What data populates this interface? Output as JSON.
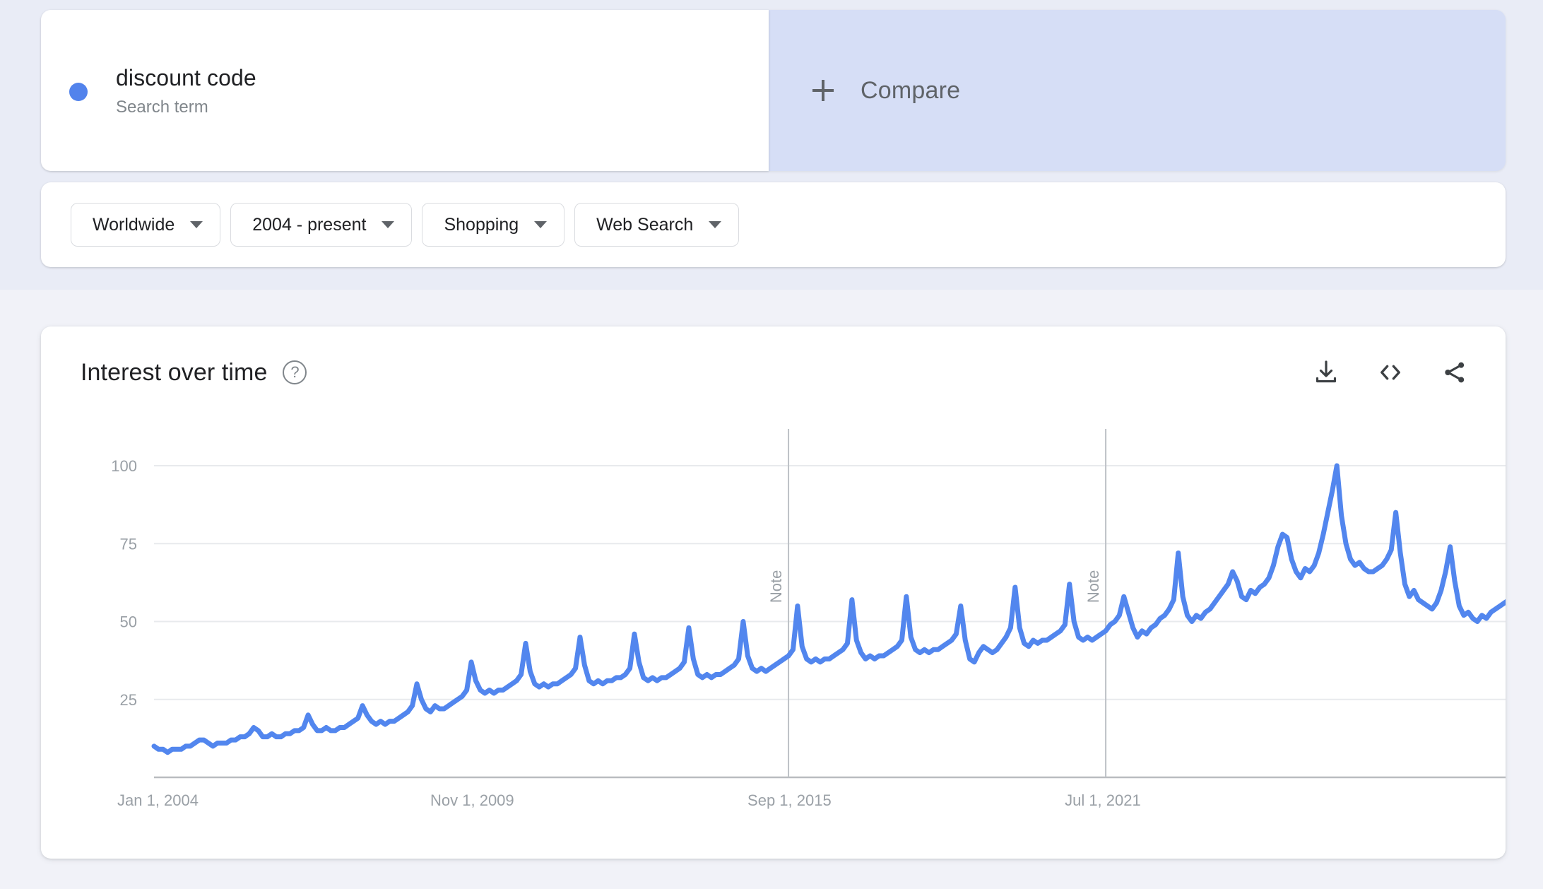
{
  "search_term": {
    "name": "discount code",
    "type_label": "Search term",
    "dot_color": "#5283ec"
  },
  "compare": {
    "label": "Compare",
    "plus_icon": "plus-icon",
    "background": "#d6def6"
  },
  "filters": [
    {
      "label": "Worldwide",
      "icon": "chevron-down-icon"
    },
    {
      "label": "2004 - present",
      "icon": "chevron-down-icon"
    },
    {
      "label": "Shopping",
      "icon": "chevron-down-icon"
    },
    {
      "label": "Web Search",
      "icon": "chevron-down-icon"
    }
  ],
  "chart_card": {
    "title": "Interest over time",
    "help_icon": "help-circle-icon",
    "help_glyph": "?",
    "actions": [
      {
        "name": "download-icon",
        "title": "Download"
      },
      {
        "name": "embed-code-icon",
        "title": "Embed"
      },
      {
        "name": "share-icon",
        "title": "Share"
      }
    ]
  },
  "chart_data": {
    "type": "line",
    "title": "Interest over time",
    "xlabel": "",
    "ylabel": "",
    "ylim": [
      0,
      105
    ],
    "yticks": [
      25,
      50,
      75,
      100
    ],
    "ytick_labels": [
      "25",
      "50",
      "75",
      "100"
    ],
    "grid": true,
    "legend": "none",
    "line_color": "#5286ee",
    "line_width": 7,
    "xtick_labels": [
      "Jan 1, 2004",
      "Nov 1, 2009",
      "Sep 1, 2015",
      "Jul 1, 2021"
    ],
    "xtick_indices": [
      0,
      70,
      140,
      210
    ],
    "annotations": [
      {
        "label": "Note",
        "index": 140
      },
      {
        "label": "Note",
        "index": 210
      }
    ],
    "x_start": "2004-01",
    "x_end": "2023-12",
    "x_interval": "monthly",
    "series": [
      {
        "name": "discount code",
        "color": "#5286ee",
        "values": [
          10,
          9,
          9,
          8,
          9,
          9,
          9,
          10,
          10,
          11,
          12,
          12,
          11,
          10,
          11,
          11,
          11,
          12,
          12,
          13,
          13,
          14,
          16,
          15,
          13,
          13,
          14,
          13,
          13,
          14,
          14,
          15,
          15,
          16,
          20,
          17,
          15,
          15,
          16,
          15,
          15,
          16,
          16,
          17,
          18,
          19,
          23,
          20,
          18,
          17,
          18,
          17,
          18,
          18,
          19,
          20,
          21,
          23,
          30,
          25,
          22,
          21,
          23,
          22,
          22,
          23,
          24,
          25,
          26,
          28,
          37,
          31,
          28,
          27,
          28,
          27,
          28,
          28,
          29,
          30,
          31,
          33,
          43,
          34,
          30,
          29,
          30,
          29,
          30,
          30,
          31,
          32,
          33,
          35,
          45,
          36,
          31,
          30,
          31,
          30,
          31,
          31,
          32,
          32,
          33,
          35,
          46,
          37,
          32,
          31,
          32,
          31,
          32,
          32,
          33,
          34,
          35,
          37,
          48,
          38,
          33,
          32,
          33,
          32,
          33,
          33,
          34,
          35,
          36,
          38,
          50,
          39,
          35,
          34,
          35,
          34,
          35,
          36,
          37,
          38,
          39,
          41,
          55,
          42,
          38,
          37,
          38,
          37,
          38,
          38,
          39,
          40,
          41,
          43,
          57,
          44,
          40,
          38,
          39,
          38,
          39,
          39,
          40,
          41,
          42,
          44,
          58,
          45,
          41,
          40,
          41,
          40,
          41,
          41,
          42,
          43,
          44,
          46,
          55,
          44,
          38,
          37,
          40,
          42,
          41,
          40,
          41,
          43,
          45,
          48,
          61,
          48,
          43,
          42,
          44,
          43,
          44,
          44,
          45,
          46,
          47,
          49,
          62,
          50,
          45,
          44,
          45,
          44,
          45,
          46,
          47,
          49,
          50,
          52,
          58,
          53,
          48,
          45,
          47,
          46,
          48,
          49,
          51,
          52,
          54,
          57,
          72,
          58,
          52,
          50,
          52,
          51,
          53,
          54,
          56,
          58,
          60,
          62,
          66,
          63,
          58,
          57,
          60,
          59,
          61,
          62,
          64,
          68,
          74,
          78,
          77,
          70,
          66,
          64,
          67,
          66,
          68,
          72,
          78,
          85,
          92,
          100,
          84,
          75,
          70,
          68,
          69,
          67,
          66,
          66,
          67,
          68,
          70,
          73,
          85,
          72,
          62,
          58,
          60,
          57,
          56,
          55,
          54,
          56,
          60,
          66,
          74,
          63,
          55,
          52,
          53,
          51,
          50,
          52,
          51,
          53,
          54,
          55,
          56,
          57
        ]
      }
    ]
  }
}
